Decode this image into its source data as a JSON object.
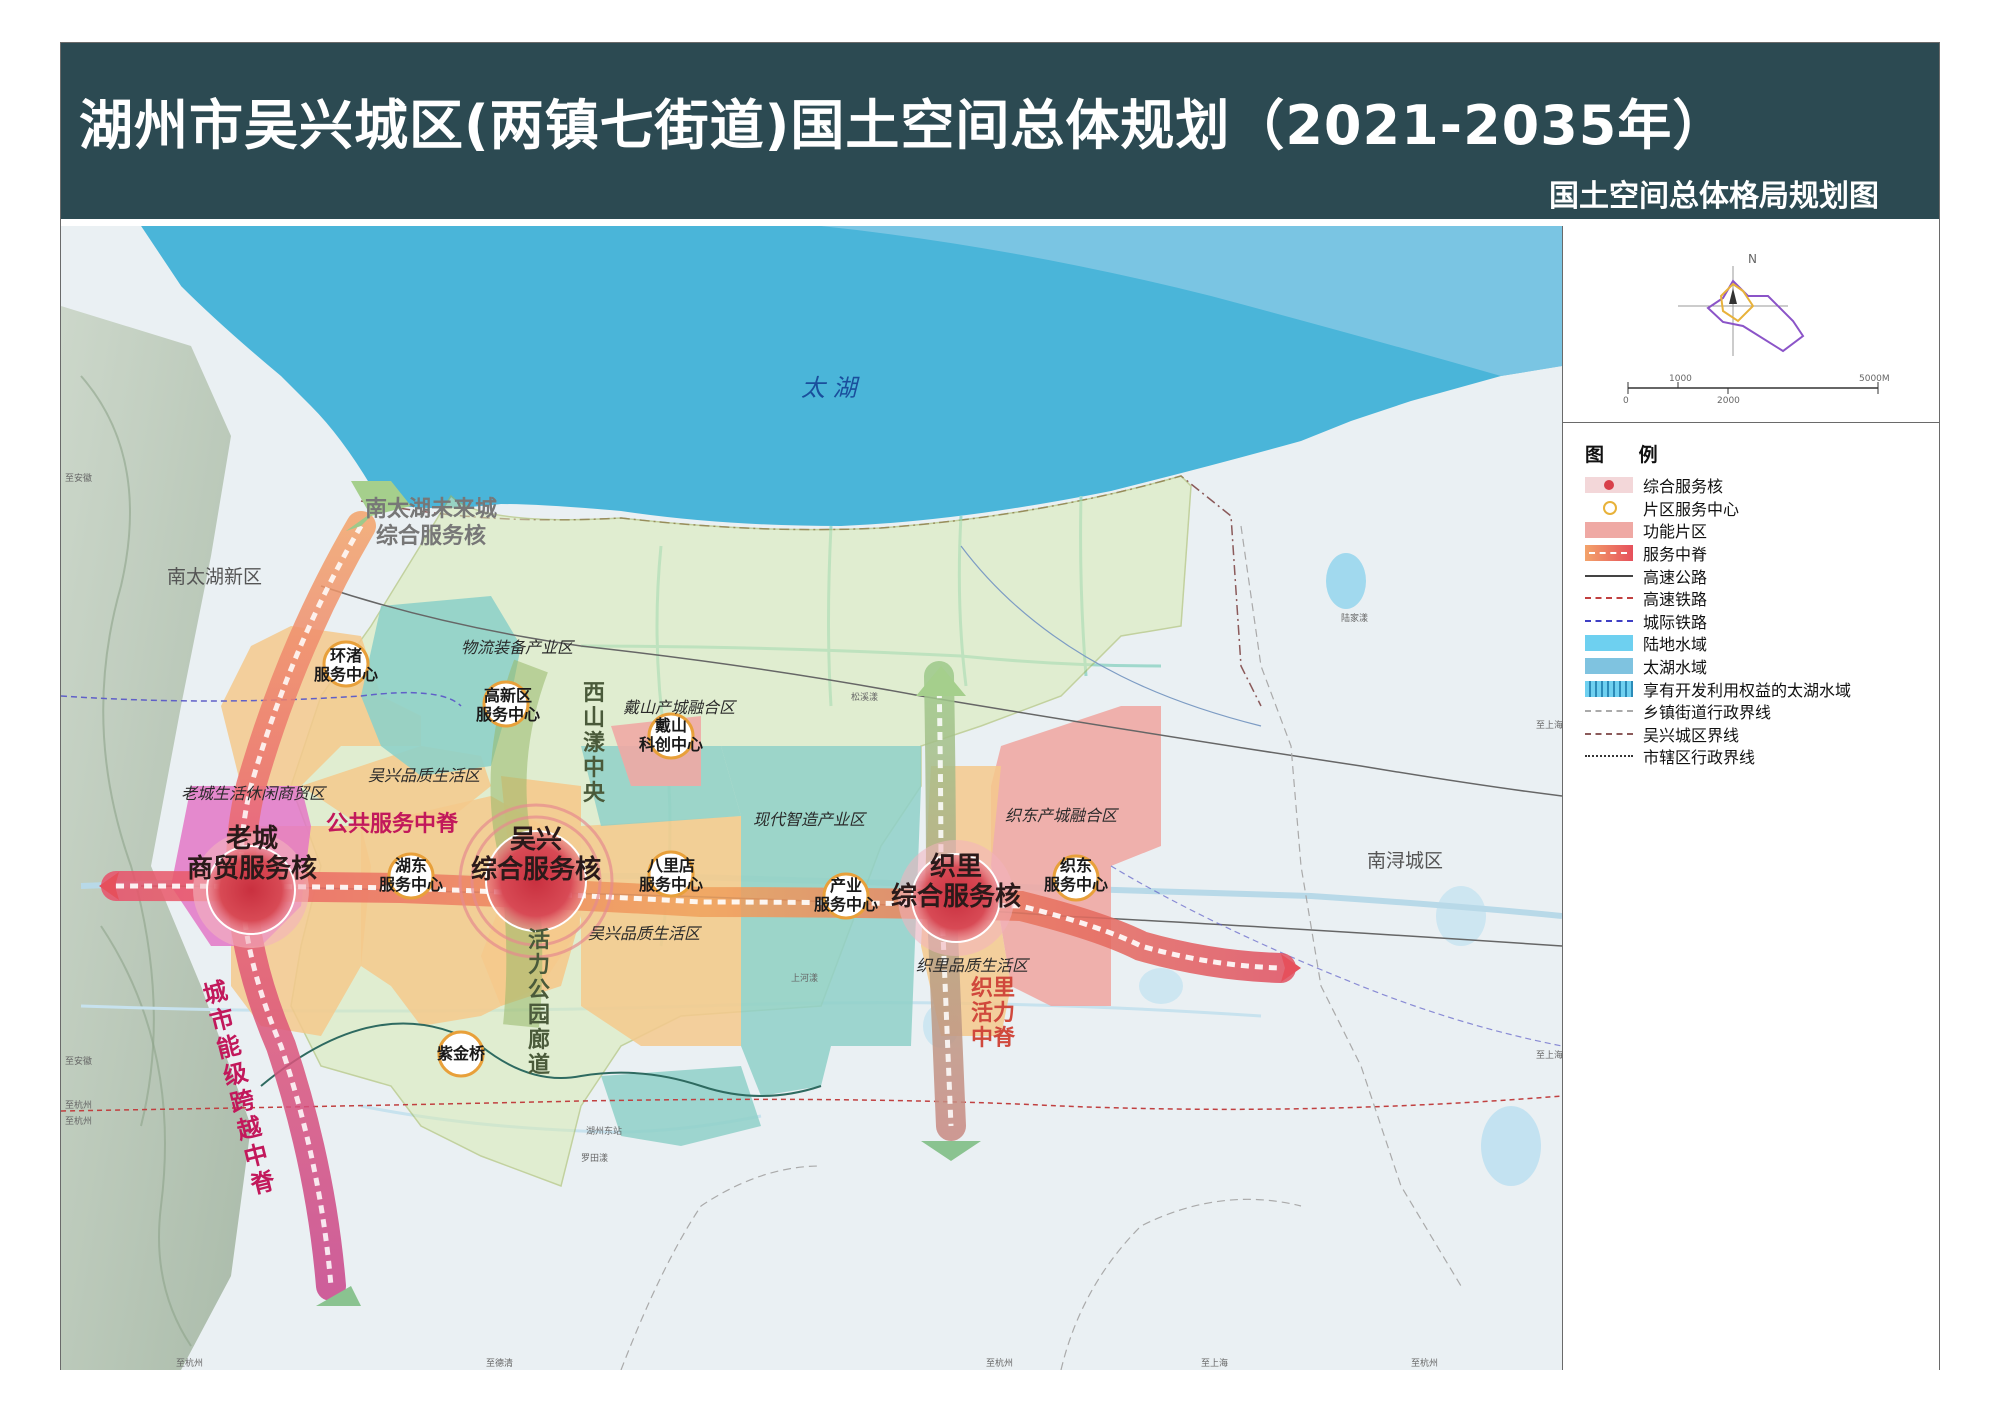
{
  "header": {
    "title": "湖州市吴兴城区(两镇七街道)国土空间总体规划（2021-2035年）",
    "subtitle": "国土空间总体格局规划图"
  },
  "map": {
    "lake_label": "太 湖",
    "regions": {
      "nantaihu_new": "南太湖新区",
      "nanxun": "南浔城区"
    },
    "cores": {
      "laocheng": "老城\n商贸服务核",
      "wuxing": "吴兴\n综合服务核",
      "zhili": "织里\n综合服务核",
      "nantaihu": "南太湖未来城\n综合服务核"
    },
    "centers": {
      "huanzhu": "环渚\n服务中心",
      "gaoxin": "高新区\n服务中心",
      "daishan": "戴山\n科创中心",
      "hudong": "湖东\n服务中心",
      "balidian": "八里店\n服务中心",
      "chanye": "产业\n服务中心",
      "zhidong": "织东\n服务中心",
      "zijinqiao": "紫金桥"
    },
    "zones": {
      "wuliu": "物流装备产业区",
      "daishan_fusion": "戴山产城融合区",
      "wuxing_life_n": "吴兴品质生活区",
      "laocheng_leisure": "老城生活休闲商贸区",
      "modern_industry": "现代智造产业区",
      "zhidong_fusion": "织东产城融合区",
      "wuxing_life_s": "吴兴品质生活区",
      "zhili_life": "织里品质生活区"
    },
    "spines": {
      "public_service": "公共服务中脊",
      "city_level": "城市能级跨越中脊",
      "xishan": "西山漾中央",
      "park_corridor": "活力公园廊道",
      "zhili_vitality": "织里活力中脊"
    },
    "edge_labels": {
      "l1": "至安徽",
      "l2": "至安徽",
      "l3": "至杭州",
      "l4": "至杭州",
      "r1": "至上海",
      "r2": "至上海",
      "b1": "至杭州",
      "b2": "至德清",
      "b3": "至杭州",
      "b4": "至上海",
      "b5": "至杭州"
    },
    "place_labels": {
      "station": "湖州东站",
      "luotian": "罗田漾",
      "shanghe": "上河漾",
      "songyuan": "松溪漾",
      "luyang": "陆家漾"
    }
  },
  "compass": {
    "north": "N",
    "scale_top": [
      "1000",
      "5000M"
    ],
    "scale_bottom": [
      "0",
      "2000"
    ]
  },
  "legend": {
    "title": "图 例",
    "items": [
      {
        "icon": "core-icon",
        "label": "综合服务核"
      },
      {
        "icon": "center-icon",
        "label": "片区服务中心"
      },
      {
        "icon": "zone-icon",
        "label": "功能片区"
      },
      {
        "icon": "spine-icon",
        "label": "服务中脊"
      },
      {
        "icon": "expressway-icon",
        "label": "高速公路"
      },
      {
        "icon": "hsr-icon",
        "label": "高速铁路"
      },
      {
        "icon": "intercity-rail-icon",
        "label": "城际铁路"
      },
      {
        "icon": "land-water-icon",
        "label": "陆地水域"
      },
      {
        "icon": "lake-water-icon",
        "label": "太湖水域"
      },
      {
        "icon": "taihu-rights-icon",
        "label": "享有开发利用权益的太湖水域"
      },
      {
        "icon": "town-boundary-icon",
        "label": "乡镇街道行政界线"
      },
      {
        "icon": "district-boundary-icon",
        "label": "吴兴城区界线"
      },
      {
        "icon": "city-boundary-icon",
        "label": "市辖区行政界线"
      }
    ]
  },
  "colors": {
    "header_bg": "#2c4a52",
    "lake": "#4ab5d9",
    "core": "#d8404a",
    "spine_red": "#e65a62",
    "spine_green": "#9ec98a",
    "zone_pink": "#efa9a4",
    "zone_orange": "#f5c98c",
    "zone_teal": "#8fd0c8"
  }
}
